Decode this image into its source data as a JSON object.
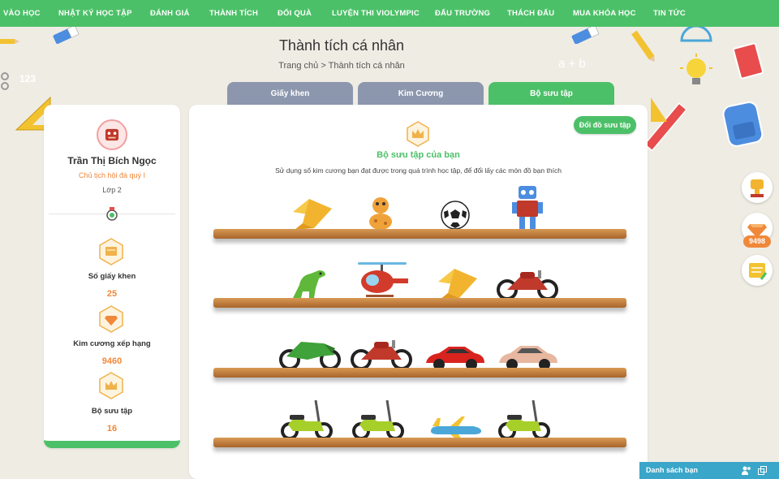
{
  "nav": {
    "items": [
      "VÀO HỌC",
      "NHẬT KÝ HỌC TẬP",
      "ĐÁNH GIÁ",
      "THÀNH TÍCH",
      "ĐỔI QUÀ",
      "LUYỆN THI VIOLYMPIC",
      "ĐẤU TRƯỜNG",
      "THÁCH ĐẤU",
      "MUA KHÓA HỌC",
      "TIN TỨC"
    ]
  },
  "page": {
    "title": "Thành tích cá nhân",
    "breadcrumb": "Trang chủ > Thành tích cá nhân"
  },
  "tabs": [
    "Giấy khen",
    "Kim Cương",
    "Bộ sưu tập"
  ],
  "active_tab": "Bộ sưu tập",
  "profile": {
    "name": "Trần Thị Bích Ngọc",
    "title": "Chủ tịch hội đá quý I",
    "class": "Lớp 2",
    "stats": [
      {
        "label": "Số giấy khen",
        "value": "25",
        "icon": "certificate-icon"
      },
      {
        "label": "Kim cương xếp hạng",
        "value": "9460",
        "icon": "diamond-icon"
      },
      {
        "label": "Bộ sưu tập",
        "value": "16",
        "icon": "crown-icon"
      }
    ]
  },
  "collection": {
    "exchange_button": "Đổi đồ sưu tập",
    "title": "Bộ sưu tập của bạn",
    "description": "Sử dụng số kim cương bạn đạt được trong quá trình học tập, để đổi lấy các món đồ bạn thích",
    "shelves": [
      [
        "origami-crane",
        "giraffe-toy",
        "soccer-ball",
        "robot-toy"
      ],
      [
        "dinosaur-toy",
        "helicopter-toy",
        "origami-crane",
        "motorcycle"
      ],
      [
        "sport-motorbike",
        "motorcycle",
        "red-sports-car",
        "sedan-car"
      ],
      [
        "scooter",
        "scooter",
        "airplane-toy",
        "scooter"
      ]
    ]
  },
  "sidebar": {
    "diamond_count": "9498"
  },
  "friends_bar": {
    "label": "Danh sách bạn"
  },
  "colors": {
    "brand_green": "#4cc068",
    "tab_gray": "#8c97ae",
    "accent_orange": "#f0883a",
    "friends_blue": "#3aa6c9"
  }
}
